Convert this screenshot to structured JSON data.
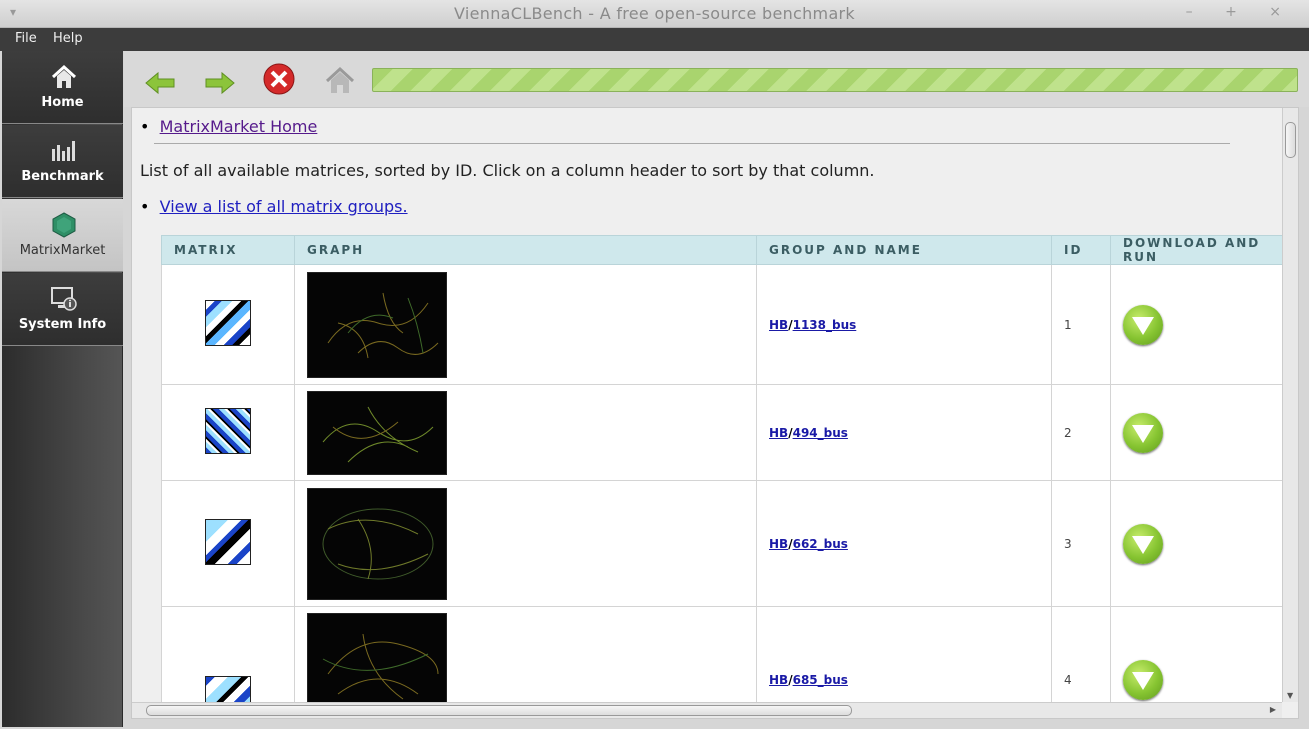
{
  "window": {
    "title": "ViennaCLBench - A free open-source benchmark",
    "menu_glyph": "▾",
    "controls": "– + ×"
  },
  "menubar": {
    "items": [
      "File",
      "Help"
    ]
  },
  "sidebar": {
    "items": [
      {
        "label": "Home",
        "icon": "home-icon"
      },
      {
        "label": "Benchmark",
        "icon": "bar-chart-icon"
      },
      {
        "label": "MatrixMarket",
        "icon": "hexagon-icon",
        "active": true
      },
      {
        "label": "System Info",
        "icon": "computer-info-icon"
      }
    ]
  },
  "toolbar": {
    "buttons": [
      "back-arrow-icon",
      "forward-arrow-icon",
      "stop-icon",
      "home-icon"
    ],
    "progress_percent": 100
  },
  "content": {
    "home_link": "MatrixMarket Home",
    "intro": "List of all available matrices, sorted by ID. Click on a column header to sort by that column.",
    "groups_link": "View a list of all matrix groups.",
    "table": {
      "headers": [
        "MATRIX",
        "GRAPH",
        "GROUP AND NAME",
        "ID",
        "DOWNLOAD AND RUN"
      ],
      "rows": [
        {
          "group": "HB",
          "name": "1138_bus",
          "id": "1"
        },
        {
          "group": "HB",
          "name": "494_bus",
          "id": "2"
        },
        {
          "group": "HB",
          "name": "662_bus",
          "id": "3"
        },
        {
          "group": "HB",
          "name": "685_bus",
          "id": "4"
        }
      ]
    }
  },
  "colors": {
    "accent_green": "#86c431",
    "table_header_bg": "#cfe8ec",
    "link": "#1a1aa6",
    "stop_red": "#d42a2a"
  }
}
